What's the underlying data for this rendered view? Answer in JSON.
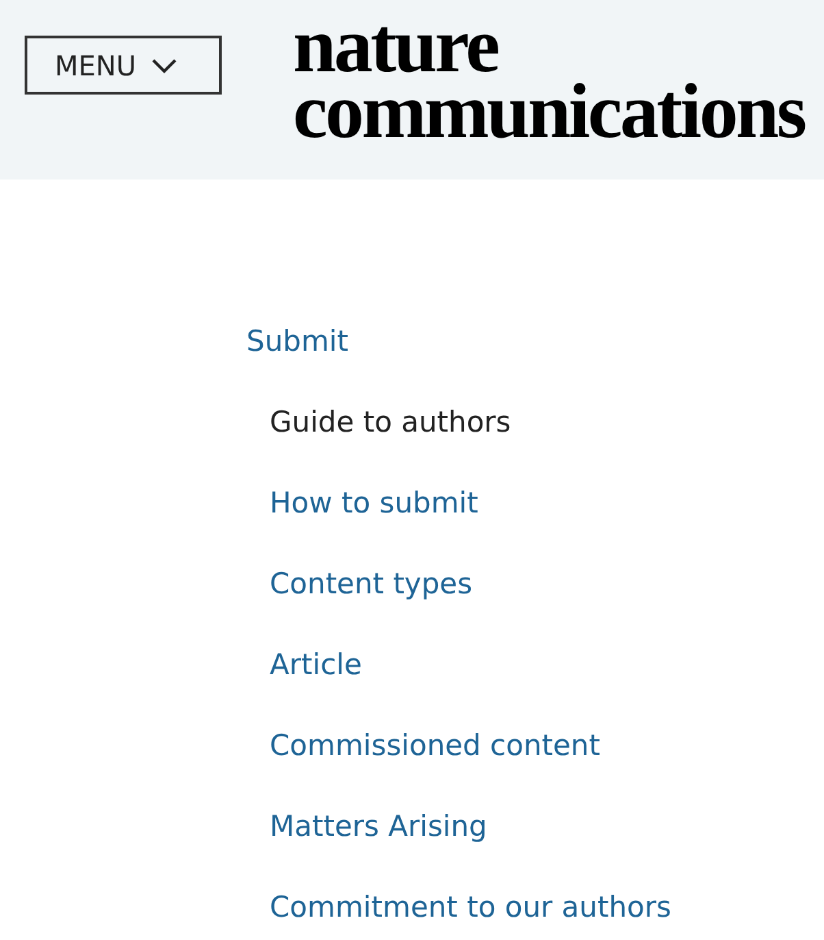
{
  "header": {
    "menu_button": {
      "label": "MENU"
    },
    "logo": [
      "nature",
      "communications"
    ]
  },
  "nav": {
    "heading": "Submit",
    "items": [
      {
        "label": "Guide to authors",
        "selected": true
      },
      {
        "label": "How to submit",
        "selected": false
      },
      {
        "label": "Content types",
        "selected": false
      },
      {
        "label": "Article",
        "selected": false
      },
      {
        "label": "Commissioned content",
        "selected": false
      },
      {
        "label": "Matters Arising",
        "selected": false
      },
      {
        "label": "Commitment to our authors",
        "selected": false
      }
    ]
  }
}
